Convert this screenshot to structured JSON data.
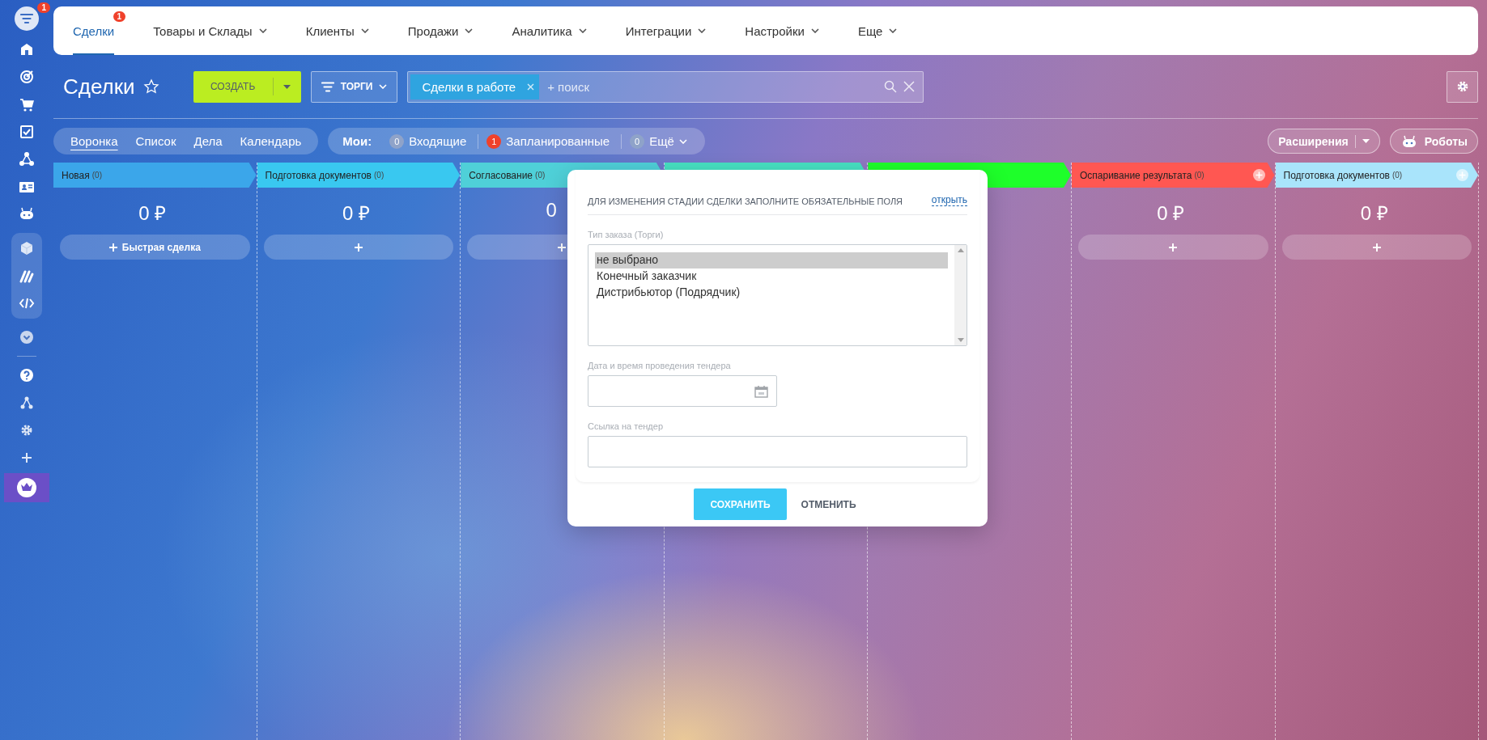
{
  "sidebar": {
    "badge": "1"
  },
  "nav": [
    {
      "label": "Сделки",
      "selected": true,
      "badge": "1",
      "dropdown": false
    },
    {
      "label": "Товары и Склады",
      "selected": false,
      "dropdown": true
    },
    {
      "label": "Клиенты",
      "selected": false,
      "dropdown": true
    },
    {
      "label": "Продажи",
      "selected": false,
      "dropdown": true
    },
    {
      "label": "Аналитика",
      "selected": false,
      "dropdown": true
    },
    {
      "label": "Интеграции",
      "selected": false,
      "dropdown": true
    },
    {
      "label": "Настройки",
      "selected": false,
      "dropdown": true
    },
    {
      "label": "Еще",
      "selected": false,
      "dropdown": true
    }
  ],
  "toolbar": {
    "title": "Сделки",
    "create_button": "СОЗДАТЬ",
    "filter_button": "ТОРГИ",
    "search": {
      "tag": "Сделки в работе",
      "placeholder": "+ поиск"
    }
  },
  "view_tabs": [
    {
      "label": "Воронка",
      "selected": true
    },
    {
      "label": "Список",
      "selected": false
    },
    {
      "label": "Дела",
      "selected": false
    },
    {
      "label": "Календарь",
      "selected": false
    }
  ],
  "my": {
    "label": "Мои:",
    "counters": [
      {
        "count": "0",
        "label": "Входящие",
        "color": "#8fa3c9",
        "dropdown": false
      },
      {
        "count": "1",
        "label": "Запланированные",
        "color": "#f0412b",
        "dropdown": false
      },
      {
        "count": "0",
        "label": "Ещё",
        "color": "#8fa3c9",
        "dropdown": true
      }
    ]
  },
  "extensions_button": "Расширения",
  "robots_button": "Роботы",
  "columns": [
    {
      "name": "Новая",
      "count": "(0)",
      "color": "#3ba6ea",
      "amount": "0 ₽",
      "button": "Быстрая сделка",
      "add_stage": false
    },
    {
      "name": "Подготовка документов",
      "count": "(0)",
      "color": "#39c8f0",
      "amount": "0 ₽",
      "add_stage": false
    },
    {
      "name": "Согласование",
      "count": "(0)",
      "color": "#4fd0d8",
      "amount": "0",
      "add_stage": false
    },
    {
      "color": "#47e0c2",
      "add_stage": false
    },
    {
      "color": "#1eff2a",
      "add_stage": false
    },
    {
      "name": "Оспаривание результата",
      "count": "(0)",
      "color": "#ff5752",
      "amount": "0 ₽",
      "add_stage": true
    },
    {
      "name": "Подготовка документов",
      "count": "(0)",
      "color": "#a9e4fb",
      "amount": "0 ₽",
      "add_stage": true
    }
  ],
  "dialog": {
    "title": "ДЛЯ ИЗМЕНЕНИЯ СТАДИИ СДЕЛКИ ЗАПОЛНИТЕ ОБЯЗАТЕЛЬНЫЕ ПОЛЯ",
    "link": "открыть",
    "order_type": {
      "label": "Тип заказа (Торги)",
      "options": [
        {
          "label": "не выбрано",
          "selected": true
        },
        {
          "label": "Конечный заказчик",
          "selected": false
        },
        {
          "label": "Дистрибьютор (Подрядчик)",
          "selected": false
        }
      ]
    },
    "tender_date": {
      "label": "Дата и время проведения тендера"
    },
    "tender_link": {
      "label": "Ссылка на тендер"
    },
    "save_button": "СОХРАНИТЬ",
    "cancel_button": "ОТМЕНИТЬ"
  }
}
